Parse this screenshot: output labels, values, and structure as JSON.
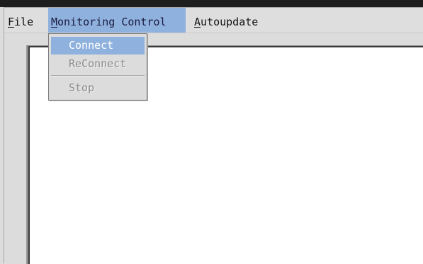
{
  "menubar": {
    "items": [
      {
        "label": "File",
        "mnemonic_index": 0
      },
      {
        "label": "Monitoring Control",
        "mnemonic_index": 0,
        "active": true
      },
      {
        "label": "Autoupdate",
        "mnemonic_index": 0
      }
    ]
  },
  "dropdown": {
    "items": [
      {
        "label": "Connect",
        "enabled": true,
        "highlighted": true
      },
      {
        "label": "ReConnect",
        "enabled": false
      },
      {
        "label": "Stop",
        "enabled": false
      }
    ]
  },
  "colors": {
    "highlight": "#8fb1dd",
    "disabled_text": "#8a8a8a",
    "menubar_bg": "#dedede",
    "client_bg": "#ffffff"
  }
}
